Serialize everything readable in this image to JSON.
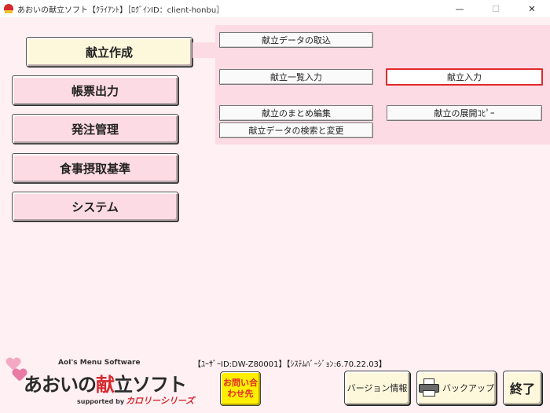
{
  "window": {
    "title": "あおいの献立ソフト【ｸﾗｲｱﾝﾄ】［ﾛｸﾞｲﾝID：client-honbu］",
    "minimize_glyph": "—",
    "maximize_glyph": "☐",
    "close_glyph": "✕"
  },
  "main_menu": {
    "items": [
      {
        "label": "献立作成",
        "active": true
      },
      {
        "label": "帳票出力"
      },
      {
        "label": "発注管理"
      },
      {
        "label": "食事摂取基準"
      },
      {
        "label": "システム"
      }
    ]
  },
  "sub_menu": {
    "items": [
      {
        "label": "献立データの取込"
      },
      {
        "label": "献立一覧入力"
      },
      {
        "label": "献立入力",
        "selected": true
      },
      {
        "label": "献立のまとめ編集"
      },
      {
        "label": "献立の展開ｺﾋﾟｰ"
      },
      {
        "label": "献立データの検索と変更"
      }
    ]
  },
  "status": {
    "text": "【ﾕｰｻﾞｰID:DW-Z80001】【ｼｽﾃﾑﾊﾞｰｼﾞｮﾝ:6.70.22.03】"
  },
  "logo": {
    "tagline": "AoI's Menu Software",
    "name_prefix": "あおいの",
    "name_highlight": "献",
    "name_suffix": "立ソフト",
    "supported_by": "supported by",
    "brand": "カロリーシリーズ"
  },
  "footer": {
    "contact_label": "お問い合わせ先",
    "version_info_label": "バージョン情報",
    "backup_label": "バックアップ",
    "exit_label": "終了"
  },
  "colors": {
    "background": "#fff0f3",
    "panel_pink": "#fcdbe4",
    "active_cream": "#fdf8dc",
    "selection_red": "#e0282a",
    "contact_yellow": "#ffee00"
  }
}
